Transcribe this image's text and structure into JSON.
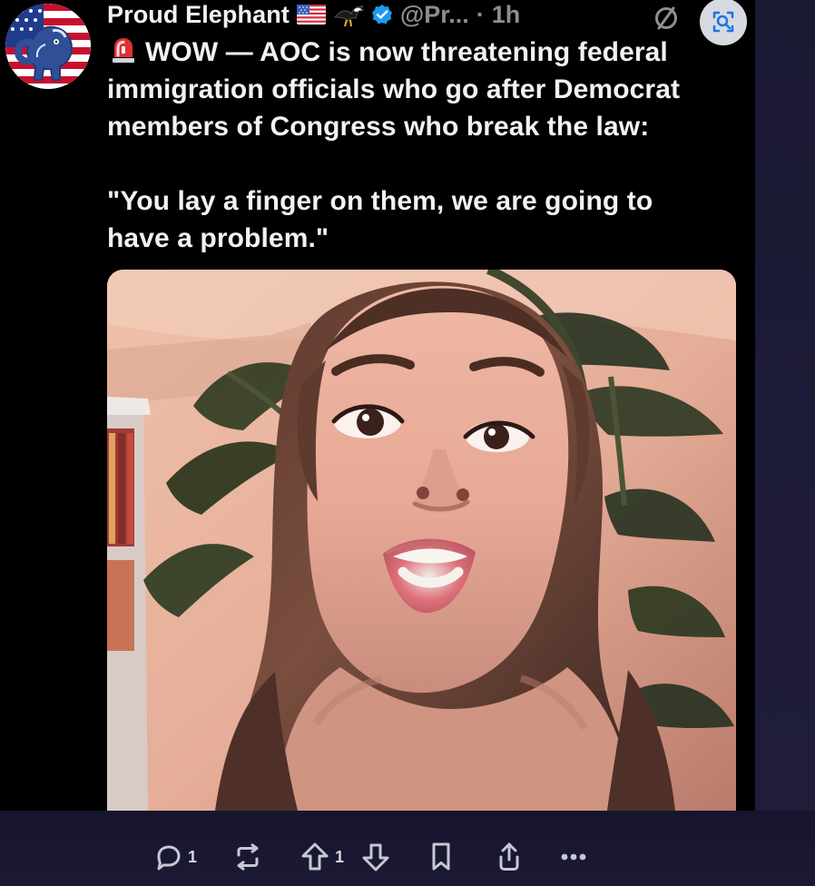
{
  "post": {
    "author": {
      "display_name": "Proud Elephant",
      "handle": "@Pr...",
      "separator": "·",
      "timestamp": "1h"
    },
    "text": {
      "line_1": "WOW — AOC is now threatening federal",
      "line_2": "immigration officials who go after Democrat",
      "line_3": "members of Congress who break the law:",
      "quote_line_1": "\"You lay a finger on them, we are going to",
      "quote_line_2": "have a problem.\""
    },
    "actions": {
      "reply_count": "1",
      "upvote_count": "1"
    }
  },
  "icons": {
    "header": [
      "flag-us-icon",
      "eagle-icon",
      "verified-badge-icon",
      "no-sign-icon",
      "visual-search-icon"
    ],
    "actions": [
      "reply-icon",
      "repost-icon",
      "upvote-icon",
      "downvote-icon",
      "bookmark-icon",
      "share-icon",
      "more-icon"
    ],
    "post": [
      "siren-icon"
    ]
  },
  "colors": {
    "post_background": "#000000",
    "text_primary": "#f2f2f2",
    "text_secondary": "#8b8d92",
    "verified": "#1d9bf0",
    "action_bar_background": "#17152d",
    "action_icon": "#c6c8d3"
  }
}
